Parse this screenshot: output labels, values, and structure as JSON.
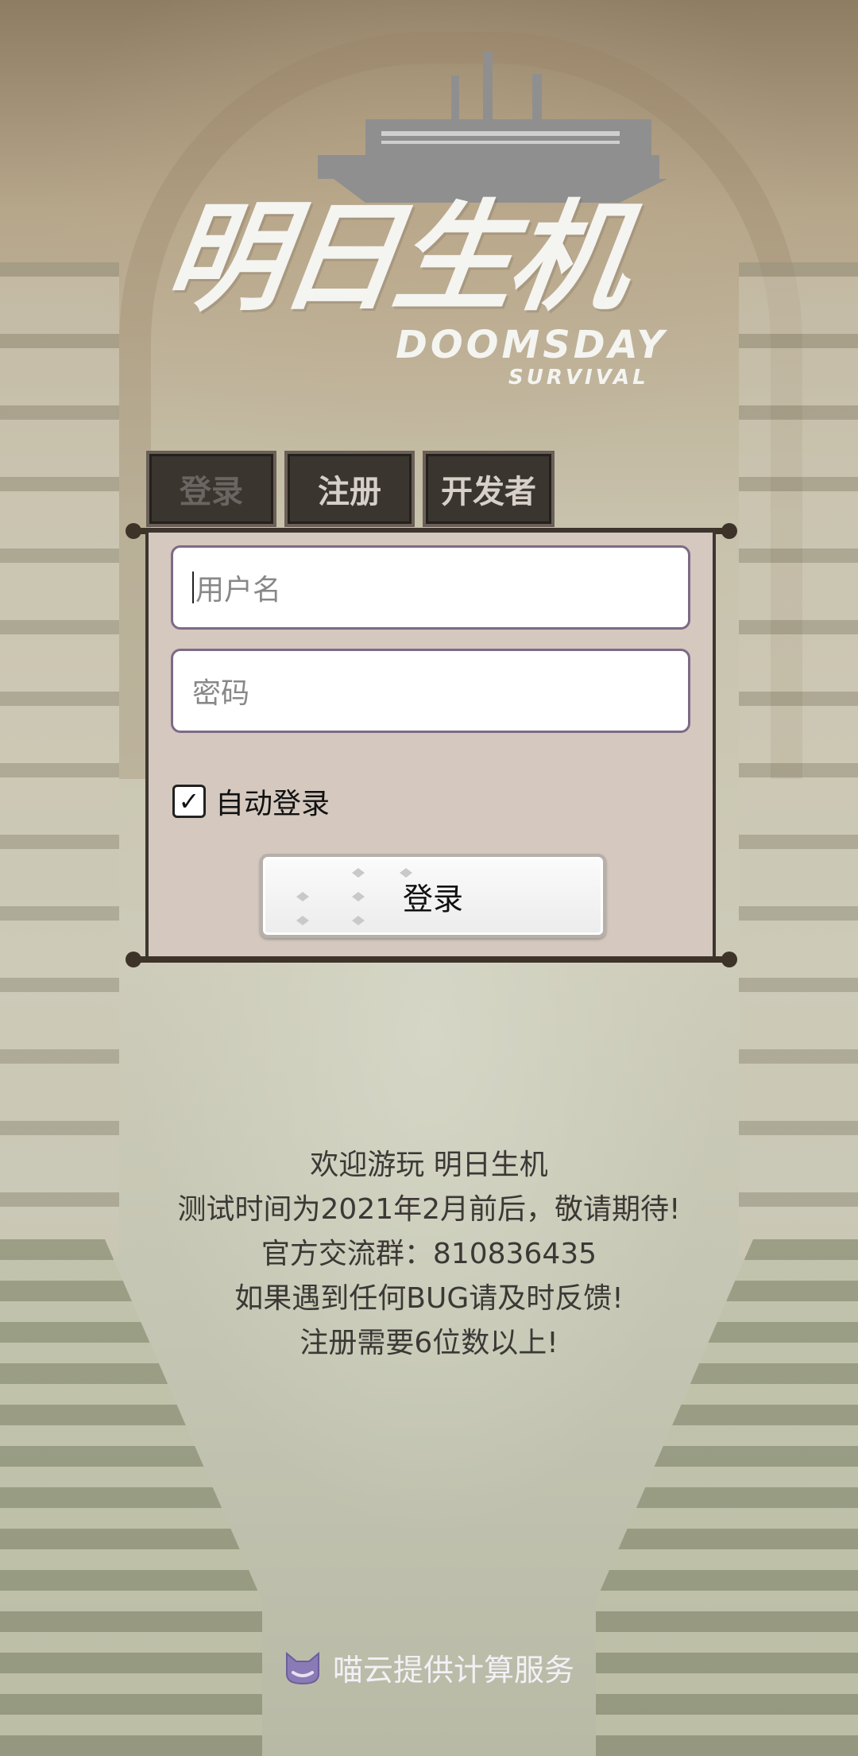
{
  "logo": {
    "title": "明日生机",
    "subtitle": "DOOMSDAY",
    "subtitle2": "SURVIVAL"
  },
  "tabs": [
    {
      "label": "登录",
      "active": true
    },
    {
      "label": "注册",
      "active": false
    },
    {
      "label": "开发者",
      "active": false
    }
  ],
  "form": {
    "username_placeholder": "用户名",
    "password_placeholder": "密码",
    "auto_login_label": "自动登录",
    "auto_login_checked": true,
    "login_button": "登录"
  },
  "info_lines": [
    "欢迎游玩 明日生机",
    "测试时间为2021年2月前后，敬请期待!",
    "官方交流群：810836435",
    "如果遇到任何BUG请及时反馈!",
    "注册需要6位数以上!"
  ],
  "footer": {
    "text": "喵云提供计算服务",
    "icon": "cat-icon"
  }
}
